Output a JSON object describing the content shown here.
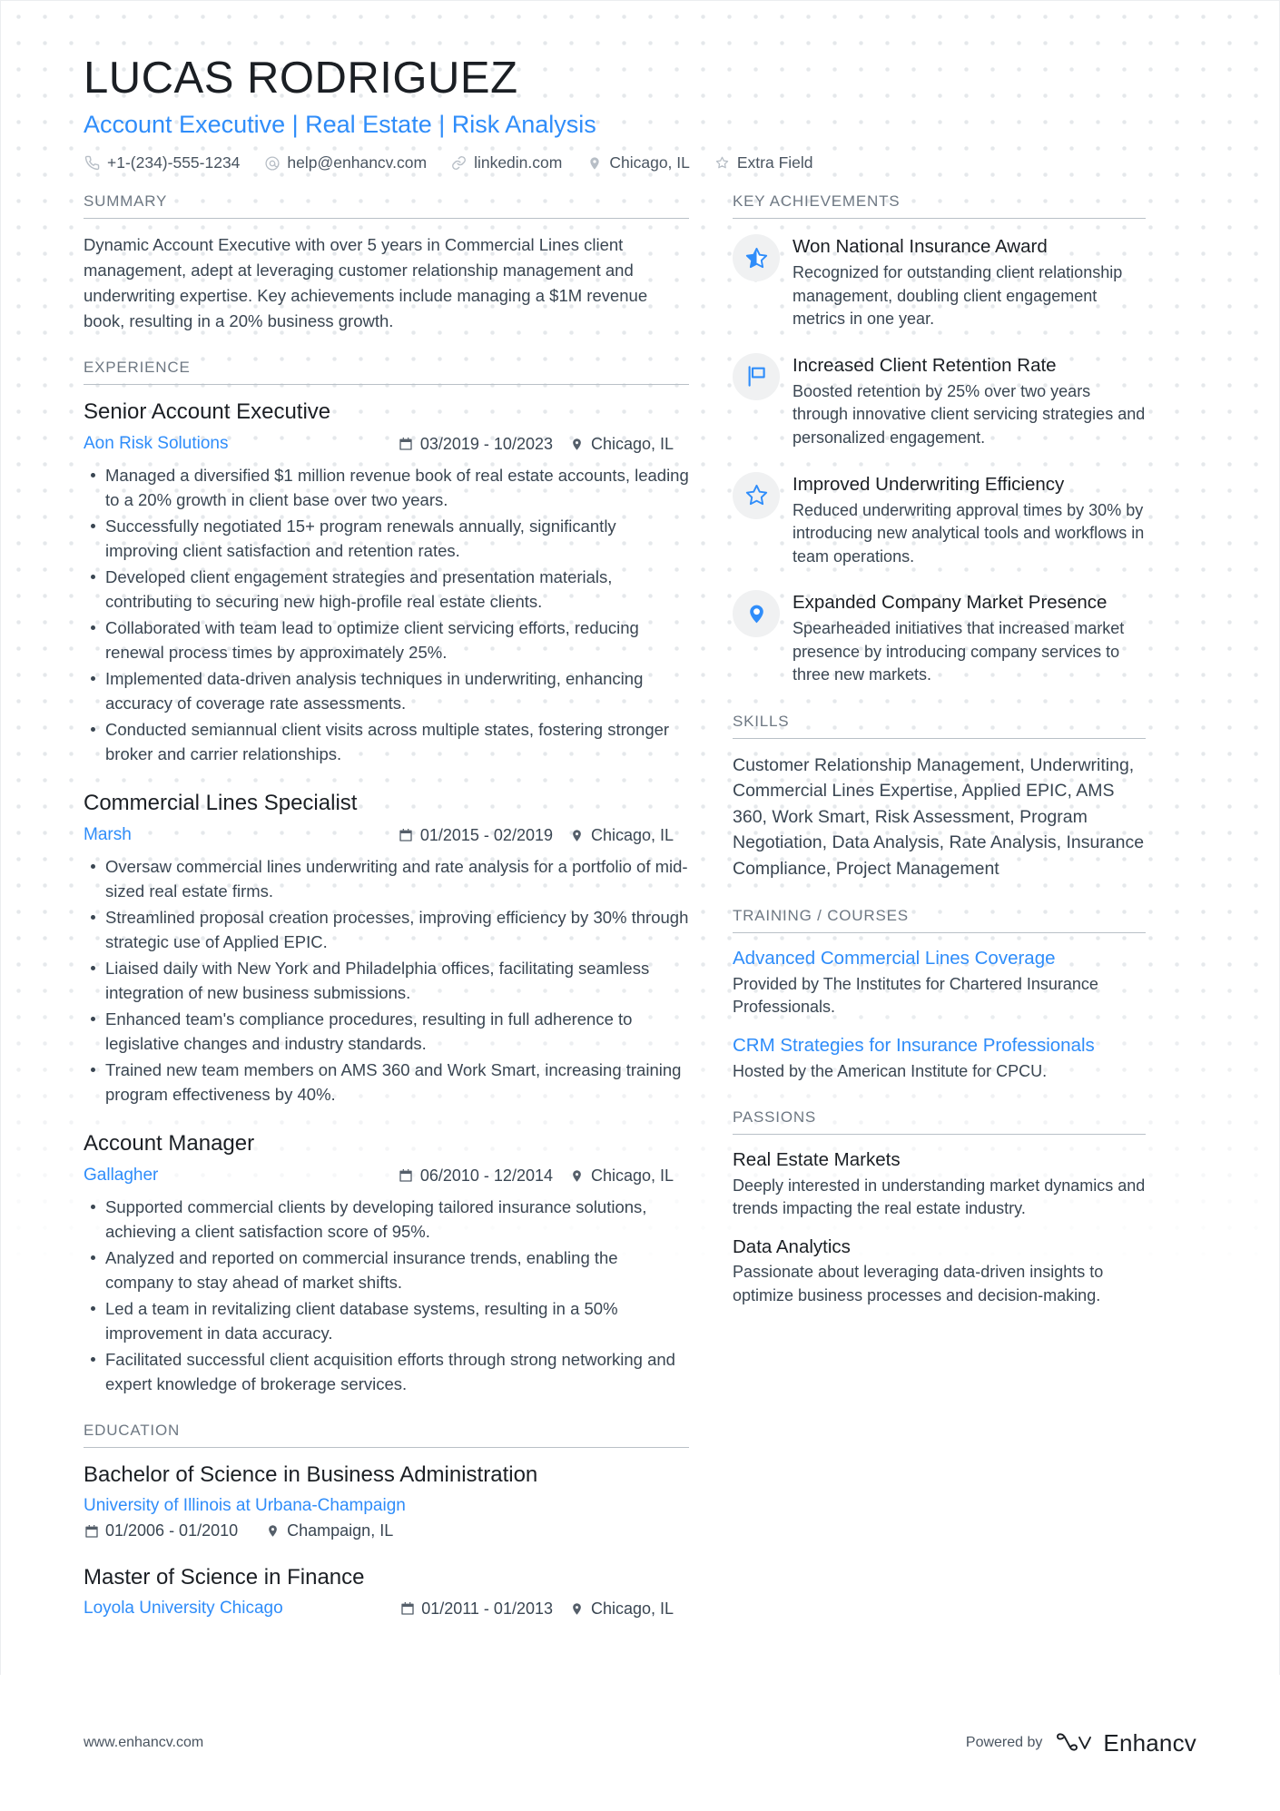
{
  "header": {
    "name": "LUCAS RODRIGUEZ",
    "headline": "Account Executive | Real Estate | Risk Analysis",
    "contacts": [
      {
        "icon": "phone-icon",
        "text": "+1-(234)-555-1234"
      },
      {
        "icon": "email-icon",
        "text": "help@enhancv.com"
      },
      {
        "icon": "link-icon",
        "text": "linkedin.com"
      },
      {
        "icon": "location-icon",
        "text": "Chicago, IL"
      },
      {
        "icon": "star-icon",
        "text": "Extra Field"
      }
    ]
  },
  "left": {
    "summary": {
      "title": "SUMMARY",
      "text": "Dynamic Account Executive with over 5 years in Commercial Lines client management, adept at leveraging customer relationship management and underwriting expertise. Key achievements include managing a $1M revenue book, resulting in a 20% business growth."
    },
    "experience": {
      "title": "EXPERIENCE",
      "entries": [
        {
          "role": "Senior Account Executive",
          "org": "Aon Risk Solutions",
          "date": "03/2019 - 10/2023",
          "location": "Chicago, IL",
          "bullets": [
            "Managed a diversified $1 million revenue book of real estate accounts, leading to a 20% growth in client base over two years.",
            "Successfully negotiated 15+ program renewals annually, significantly improving client satisfaction and retention rates.",
            "Developed client engagement strategies and presentation materials, contributing to securing new high-profile real estate clients.",
            "Collaborated with team lead to optimize client servicing efforts, reducing renewal process times by approximately 25%.",
            "Implemented data-driven analysis techniques in underwriting, enhancing accuracy of coverage rate assessments.",
            "Conducted semiannual client visits across multiple states, fostering stronger broker and carrier relationships."
          ]
        },
        {
          "role": "Commercial Lines Specialist",
          "org": "Marsh",
          "date": "01/2015 - 02/2019",
          "location": "Chicago, IL",
          "bullets": [
            "Oversaw commercial lines underwriting and rate analysis for a portfolio of mid-sized real estate firms.",
            "Streamlined proposal creation processes, improving efficiency by 30% through strategic use of Applied EPIC.",
            "Liaised daily with New York and Philadelphia offices, facilitating seamless integration of new business submissions.",
            "Enhanced team's compliance procedures, resulting in full adherence to legislative changes and industry standards.",
            "Trained new team members on AMS 360 and Work Smart, increasing training program effectiveness by 40%."
          ]
        },
        {
          "role": "Account Manager",
          "org": "Gallagher",
          "date": "06/2010 - 12/2014",
          "location": "Chicago, IL",
          "bullets": [
            "Supported commercial clients by developing tailored insurance solutions, achieving a client satisfaction score of 95%.",
            "Analyzed and reported on commercial insurance trends, enabling the company to stay ahead of market shifts.",
            "Led a team in revitalizing client database systems, resulting in a 50% improvement in data accuracy.",
            "Facilitated successful client acquisition efforts through strong networking and expert knowledge of brokerage services."
          ]
        }
      ]
    },
    "education": {
      "title": "EDUCATION",
      "entries": [
        {
          "degree": "Bachelor of Science in Business Administration",
          "school": "University of Illinois at Urbana-Champaign",
          "date": "01/2006 - 01/2010",
          "location": "Champaign, IL",
          "layout": "stacked"
        },
        {
          "degree": "Master of Science in Finance",
          "school": "Loyola University Chicago",
          "date": "01/2011 - 01/2013",
          "location": "Chicago, IL",
          "layout": "inline"
        }
      ]
    }
  },
  "right": {
    "achievements": {
      "title": "KEY ACHIEVEMENTS",
      "items": [
        {
          "icon": "half-star-icon",
          "title": "Won National Insurance Award",
          "desc": "Recognized for outstanding client relationship management, doubling client engagement metrics in one year."
        },
        {
          "icon": "flag-icon",
          "title": "Increased Client Retention Rate",
          "desc": "Boosted retention by 25% over two years through innovative client servicing strategies and personalized engagement."
        },
        {
          "icon": "star-outline-icon",
          "title": "Improved Underwriting Efficiency",
          "desc": "Reduced underwriting approval times by 30% by introducing new analytical tools and workflows in team operations."
        },
        {
          "icon": "map-pin-icon",
          "title": "Expanded Company Market Presence",
          "desc": "Spearheaded initiatives that increased market presence by introducing company services to three new markets."
        }
      ]
    },
    "skills": {
      "title": "SKILLS",
      "text": "Customer Relationship Management, Underwriting, Commercial Lines Expertise, Applied EPIC, AMS 360, Work Smart, Risk Assessment, Program Negotiation, Data Analysis, Rate Analysis, Insurance Compliance, Project Management"
    },
    "training": {
      "title": "TRAINING / COURSES",
      "items": [
        {
          "name": "Advanced Commercial Lines Coverage",
          "desc": "Provided by The Institutes for Chartered Insurance Professionals."
        },
        {
          "name": "CRM Strategies for Insurance Professionals",
          "desc": "Hosted by the American Institute for CPCU."
        }
      ]
    },
    "passions": {
      "title": "PASSIONS",
      "items": [
        {
          "name": "Real Estate Markets",
          "desc": "Deeply interested in understanding market dynamics and trends impacting the real estate industry."
        },
        {
          "name": "Data Analytics",
          "desc": "Passionate about leveraging data-driven insights to optimize business processes and decision-making."
        }
      ]
    }
  },
  "footer": {
    "website": "www.enhancv.com",
    "powered_by": "Powered by",
    "brand": "Enhancv"
  },
  "colors": {
    "accent_blue": "#2f8dfa",
    "heading_dark": "#1b1f24",
    "body_text": "#3a4652",
    "section_label": "#6e7883",
    "rule": "#b9c0c7",
    "bubble": "#f0f1f2"
  }
}
